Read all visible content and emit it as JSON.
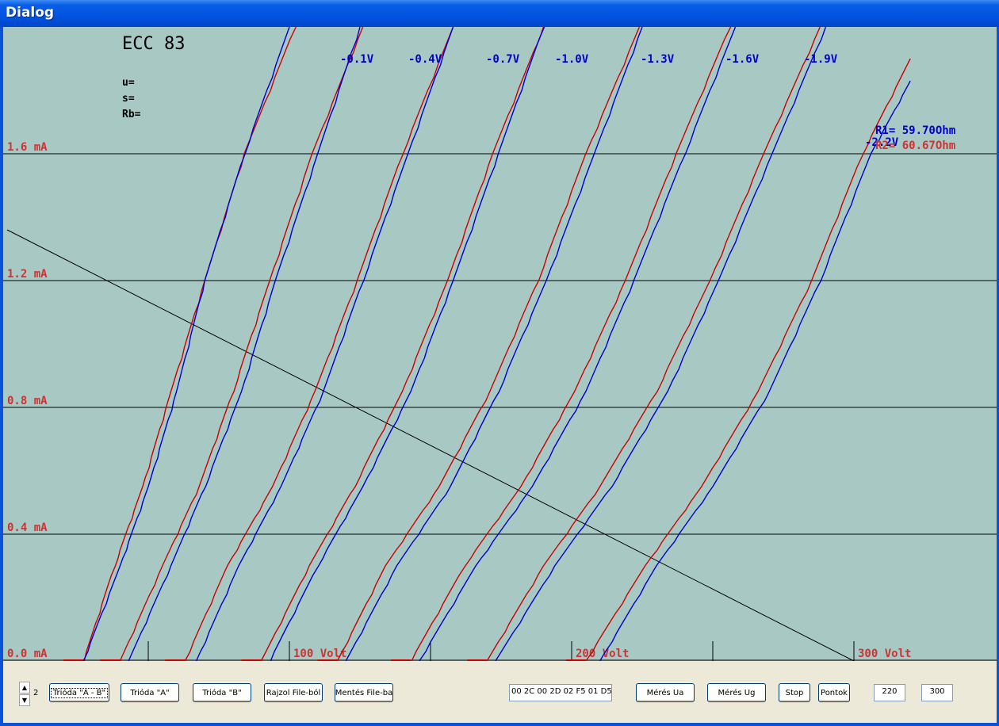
{
  "window": {
    "title": "Dialog"
  },
  "chart_data": {
    "type": "line",
    "tube": "ECC 83",
    "params": [
      "u=",
      "s=",
      "Rb="
    ],
    "x_range": [
      0,
      340
    ],
    "y_range": [
      0,
      2.0
    ],
    "y_ticks": [
      {
        "value": 0.0,
        "label": "0.0 mA"
      },
      {
        "value": 0.4,
        "label": "0.4 mA"
      },
      {
        "value": 0.8,
        "label": "0.8 mA"
      },
      {
        "value": 1.2,
        "label": "1.2 mA"
      },
      {
        "value": 1.6,
        "label": "1.6 mA"
      }
    ],
    "x_ticks": [
      {
        "value": 50,
        "label": ""
      },
      {
        "value": 100,
        "label": "100 Volt"
      },
      {
        "value": 150,
        "label": ""
      },
      {
        "value": 200,
        "label": "200 Volt"
      },
      {
        "value": 250,
        "label": ""
      },
      {
        "value": 300,
        "label": "300 Volt"
      }
    ],
    "grid": true,
    "colors": {
      "background": "#a8c9c3",
      "triode_a": "#0000cc",
      "triode_b": "#cc0000",
      "tick_labels": "#cc3333",
      "load_line": "#000000"
    },
    "curve_labels": [
      "-0.1V",
      "-0.4V",
      "-0.7V",
      "-1.0V",
      "-1.3V",
      "-1.6V",
      "-1.9V",
      "-2.2V"
    ],
    "series": [
      {
        "grid_voltage": "-0.1V",
        "a": [
          [
            27,
            0
          ],
          [
            40,
            0.3
          ],
          [
            50,
            0.55
          ],
          [
            60,
            0.85
          ],
          [
            70,
            1.2
          ],
          [
            84,
            1.6
          ],
          [
            100,
            2.0
          ]
        ],
        "b": [
          [
            27,
            0
          ],
          [
            38,
            0.3
          ],
          [
            48,
            0.55
          ],
          [
            58,
            0.85
          ],
          [
            70,
            1.2
          ],
          [
            84,
            1.6
          ],
          [
            102,
            2.0
          ]
        ]
      },
      {
        "grid_voltage": "-0.4V",
        "a": [
          [
            43,
            0
          ],
          [
            58,
            0.3
          ],
          [
            70,
            0.55
          ],
          [
            83,
            0.85
          ],
          [
            95,
            1.2
          ],
          [
            110,
            1.6
          ],
          [
            125,
            2.0
          ]
        ],
        "b": [
          [
            40,
            0
          ],
          [
            55,
            0.3
          ],
          [
            68,
            0.55
          ],
          [
            80,
            0.85
          ],
          [
            93,
            1.2
          ],
          [
            108,
            1.6
          ],
          [
            126,
            2.0
          ]
        ]
      },
      {
        "grid_voltage": "-0.7V",
        "a": [
          [
            67,
            0
          ],
          [
            82,
            0.3
          ],
          [
            97,
            0.55
          ],
          [
            112,
            0.85
          ],
          [
            126,
            1.2
          ],
          [
            142,
            1.6
          ],
          [
            158,
            2.0
          ]
        ],
        "b": [
          [
            63,
            0
          ],
          [
            78,
            0.3
          ],
          [
            94,
            0.55
          ],
          [
            109,
            0.85
          ],
          [
            124,
            1.2
          ],
          [
            140,
            1.6
          ],
          [
            158,
            2.0
          ]
        ]
      },
      {
        "grid_voltage": "-1.0V",
        "a": [
          [
            93,
            0
          ],
          [
            110,
            0.3
          ],
          [
            126,
            0.55
          ],
          [
            143,
            0.85
          ],
          [
            158,
            1.2
          ],
          [
            174,
            1.6
          ],
          [
            190,
            2.0
          ]
        ],
        "b": [
          [
            90,
            0
          ],
          [
            107,
            0.3
          ],
          [
            123,
            0.55
          ],
          [
            140,
            0.85
          ],
          [
            156,
            1.2
          ],
          [
            172,
            1.6
          ],
          [
            190,
            2.0
          ]
        ]
      },
      {
        "grid_voltage": "-1.3V",
        "a": [
          [
            120,
            0
          ],
          [
            138,
            0.3
          ],
          [
            157,
            0.55
          ],
          [
            174,
            0.85
          ],
          [
            191,
            1.2
          ],
          [
            208,
            1.6
          ],
          [
            225,
            2.0
          ]
        ],
        "b": [
          [
            117,
            0
          ],
          [
            134,
            0.3
          ],
          [
            153,
            0.55
          ],
          [
            171,
            0.85
          ],
          [
            188,
            1.2
          ],
          [
            205,
            1.6
          ],
          [
            224,
            2.0
          ]
        ]
      },
      {
        "grid_voltage": "-1.6V",
        "a": [
          [
            146,
            0
          ],
          [
            166,
            0.3
          ],
          [
            186,
            0.55
          ],
          [
            205,
            0.85
          ],
          [
            222,
            1.2
          ],
          [
            240,
            1.6
          ],
          [
            258,
            2.0
          ]
        ],
        "b": [
          [
            143,
            0
          ],
          [
            162,
            0.3
          ],
          [
            182,
            0.55
          ],
          [
            201,
            0.85
          ],
          [
            219,
            1.2
          ],
          [
            237,
            1.6
          ],
          [
            256,
            2.0
          ]
        ]
      },
      {
        "grid_voltage": "-1.9V",
        "a": [
          [
            173,
            0
          ],
          [
            194,
            0.3
          ],
          [
            214,
            0.55
          ],
          [
            234,
            0.85
          ],
          [
            252,
            1.2
          ],
          [
            271,
            1.6
          ],
          [
            290,
            2.0
          ]
        ],
        "b": [
          [
            170,
            0
          ],
          [
            190,
            0.3
          ],
          [
            210,
            0.55
          ],
          [
            230,
            0.85
          ],
          [
            249,
            1.2
          ],
          [
            268,
            1.6
          ],
          [
            288,
            2.0
          ]
        ]
      },
      {
        "grid_voltage": "-2.2V",
        "a": [
          [
            210,
            0
          ],
          [
            230,
            0.3
          ],
          [
            250,
            0.55
          ],
          [
            270,
            0.85
          ],
          [
            288,
            1.2
          ],
          [
            306,
            1.6
          ],
          [
            320,
            1.83
          ]
        ],
        "b": [
          [
            205,
            0
          ],
          [
            226,
            0.3
          ],
          [
            246,
            0.55
          ],
          [
            266,
            0.85
          ],
          [
            285,
            1.2
          ],
          [
            303,
            1.6
          ],
          [
            320,
            1.9
          ]
        ]
      }
    ],
    "load_line": [
      [
        0,
        1.36
      ],
      [
        300,
        0
      ]
    ],
    "annotations": [
      {
        "text": "R1= 59.70Ohm",
        "color": "#0000cc"
      },
      {
        "text": "R2= 60.67Ohm",
        "color": "#cc3333"
      }
    ]
  },
  "controls": {
    "spinner_value": "2",
    "buttons": {
      "trioda_ab": "Trióda \"A - B\"",
      "trioda_a": "Trióda  \"A\"",
      "trioda_b": "Trióda  \"B\"",
      "rajzol": "Rajzol File-ból",
      "mentes": "Mentés File-ba",
      "meres_ua": "Mérés Ua",
      "meres_ug": "Mérés Ug",
      "stop": "Stop",
      "pontok": "Pontok"
    },
    "hex_field": "00 2C 00 2D 02 F5 01 D5",
    "field_1": "220",
    "field_2": "300"
  }
}
